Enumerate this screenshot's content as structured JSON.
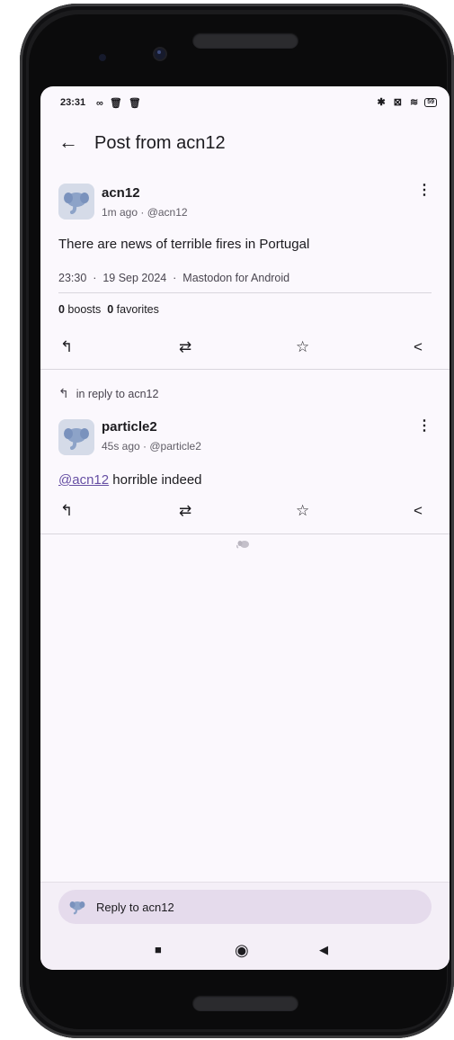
{
  "status": {
    "time": "23:31",
    "left_icons": "∞ 🗑 🗑",
    "right_icons": "✱ ⊠ ≋",
    "battery": "59"
  },
  "appbar": {
    "back_icon": "←",
    "title": "Post from acn12"
  },
  "main_post": {
    "name": "acn12",
    "sub": "1m ago · @acn12",
    "more_icon": "⋮",
    "text": "There are news of terrible fires in Portugal",
    "meta": "23:30  ·  19 Sep 2024  ·  Mastodon for Android",
    "boosts_count": "0",
    "boosts_label": " boosts",
    "favorites_count": "0",
    "favorites_label": " favorites"
  },
  "actions": {
    "reply_icon": "↰",
    "boost_icon": "⇄",
    "favorite_icon": "☆",
    "share_icon": "<"
  },
  "reply_post": {
    "in_reply_icon": "↰",
    "in_reply_text": "in reply to acn12",
    "name": "particle2",
    "sub": "45s ago · @particle2",
    "more_icon": "⋮",
    "mention": "@acn12",
    "text": " horrible indeed"
  },
  "reply_bar": {
    "placeholder": "Reply to acn12"
  },
  "navbar": {
    "recents_icon": "■",
    "home_icon": "◉",
    "back_icon": "◀"
  },
  "colors": {
    "background": "#fbf8fd",
    "accent": "#6750a4",
    "reply_pill": "#e5dbec"
  }
}
